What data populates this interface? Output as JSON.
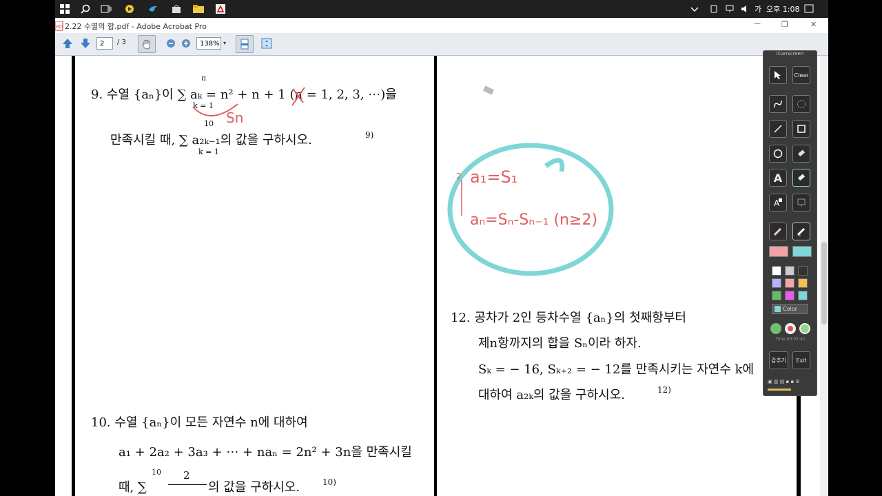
{
  "taskbar": {
    "ime_label": "가",
    "clock": "오후 1:08"
  },
  "window": {
    "title": "2.22 수열의 합.pdf - Adobe Acrobat Pro",
    "minimize": "—",
    "maximize": "❐",
    "close": "✕"
  },
  "toolbar": {
    "page_current": "2",
    "page_total": "/ 3",
    "zoom": "138%"
  },
  "problems": {
    "p9_line1": "9.  수열 {aₙ}이  ∑ aₖ = n² + n + 1 (n = 1, 2, 3, ⋯)을",
    "p9_sum_top": "n",
    "p9_sum_bottom": "k = 1",
    "p9_line2": "만족시킬 때,  ∑ a₂ₖ₋₁의 값을 구하시오.",
    "p9_sum2_top": "10",
    "p9_sum2_bottom": "k = 1",
    "p9_note": "9)",
    "p10_line1": "10.  수열 {aₙ}이 모든 자연수 n에 대하여",
    "p10_line2": "a₁ + 2a₂ + 3a₃ + ⋯ + naₙ = 2n² + 3n을 만족시킬",
    "p10_line3": "때,  ∑",
    "p10_frac_top": "2",
    "p10_sum_top": "10",
    "p10_line3b": "의 값을 구하시오.",
    "p10_note": "10)",
    "p12_line1": "12.  공차가 2인 등차수열 {aₙ}의 첫째항부터",
    "p12_line2": "제n항까지의 합을 Sₙ이라 하자.",
    "p12_line3": "Sₖ = − 16,  Sₖ₊₂ = − 12를 만족시키는 자연수 k에",
    "p12_line4": "대하여  a₂ₖ의 값을 구하시오.",
    "p12_note": "12)"
  },
  "ink": {
    "sn_label": "Sn",
    "formula1": "a₁=S₁",
    "formula2": "aₙ=Sₙ-Sₙ₋₁ (n≥2)",
    "step_mark": "2"
  },
  "icanscreen": {
    "title": "ICanScreen",
    "clear": "Clear",
    "text_tool": "A",
    "color_label": "Color",
    "time_label": "Time 00:07:41",
    "hide": "감추기",
    "exit": "Exit"
  },
  "colors": {
    "ink_red": "#e0605e",
    "ink_cyan": "#7fd6d6",
    "acrobat_blue": "#2c6fb0"
  }
}
